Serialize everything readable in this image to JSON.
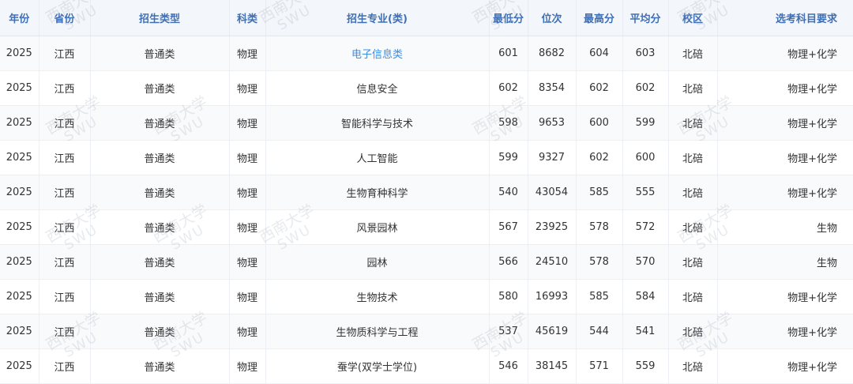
{
  "table": {
    "headers": {
      "year": "年份",
      "province": "省份",
      "admission_type": "招生类型",
      "subject_category": "科类",
      "major": "招生专业(类)",
      "min_score": "最低分",
      "rank": "位次",
      "max_score": "最高分",
      "avg_score": "平均分",
      "campus": "校区",
      "subject_requirement": "选考科目要求"
    },
    "rows": [
      {
        "year": "2025",
        "province": "江西",
        "admission_type": "普通类",
        "subject_category": "物理",
        "major": "电子信息类",
        "min_score": "601",
        "rank": "8682",
        "max_score": "604",
        "avg_score": "603",
        "campus": "北碚",
        "subject_requirement": "物理+化学"
      },
      {
        "year": "2025",
        "province": "江西",
        "admission_type": "普通类",
        "subject_category": "物理",
        "major": "信息安全",
        "min_score": "602",
        "rank": "8354",
        "max_score": "602",
        "avg_score": "602",
        "campus": "北碚",
        "subject_requirement": "物理+化学"
      },
      {
        "year": "2025",
        "province": "江西",
        "admission_type": "普通类",
        "subject_category": "物理",
        "major": "智能科学与技术",
        "min_score": "598",
        "rank": "9653",
        "max_score": "600",
        "avg_score": "599",
        "campus": "北碚",
        "subject_requirement": "物理+化学"
      },
      {
        "year": "2025",
        "province": "江西",
        "admission_type": "普通类",
        "subject_category": "物理",
        "major": "人工智能",
        "min_score": "599",
        "rank": "9327",
        "max_score": "602",
        "avg_score": "600",
        "campus": "北碚",
        "subject_requirement": "物理+化学"
      },
      {
        "year": "2025",
        "province": "江西",
        "admission_type": "普通类",
        "subject_category": "物理",
        "major": "生物育种科学",
        "min_score": "540",
        "rank": "43054",
        "max_score": "585",
        "avg_score": "555",
        "campus": "北碚",
        "subject_requirement": "物理+化学"
      },
      {
        "year": "2025",
        "province": "江西",
        "admission_type": "普通类",
        "subject_category": "物理",
        "major": "风景园林",
        "min_score": "567",
        "rank": "23925",
        "max_score": "578",
        "avg_score": "572",
        "campus": "北碚",
        "subject_requirement": "生物"
      },
      {
        "year": "2025",
        "province": "江西",
        "admission_type": "普通类",
        "subject_category": "物理",
        "major": "园林",
        "min_score": "566",
        "rank": "24510",
        "max_score": "578",
        "avg_score": "570",
        "campus": "北碚",
        "subject_requirement": "生物"
      },
      {
        "year": "2025",
        "province": "江西",
        "admission_type": "普通类",
        "subject_category": "物理",
        "major": "生物技术",
        "min_score": "580",
        "rank": "16993",
        "max_score": "585",
        "avg_score": "584",
        "campus": "北碚",
        "subject_requirement": "物理+化学"
      },
      {
        "year": "2025",
        "province": "江西",
        "admission_type": "普通类",
        "subject_category": "物理",
        "major": "生物质科学与工程",
        "min_score": "537",
        "rank": "45619",
        "max_score": "544",
        "avg_score": "541",
        "campus": "北碚",
        "subject_requirement": "物理+化学"
      },
      {
        "year": "2025",
        "province": "江西",
        "admission_type": "普通类",
        "subject_category": "物理",
        "major": "蚕学(双学士学位)",
        "min_score": "546",
        "rank": "38145",
        "max_score": "571",
        "avg_score": "559",
        "campus": "北碚",
        "subject_requirement": "物理+化学"
      }
    ]
  },
  "watermark": {
    "cn": "西南大学",
    "en": "SWU"
  },
  "colors": {
    "header_text": "#3f6fb5",
    "header_bg": "#f3f6fa",
    "link": "#3a8ee6"
  }
}
